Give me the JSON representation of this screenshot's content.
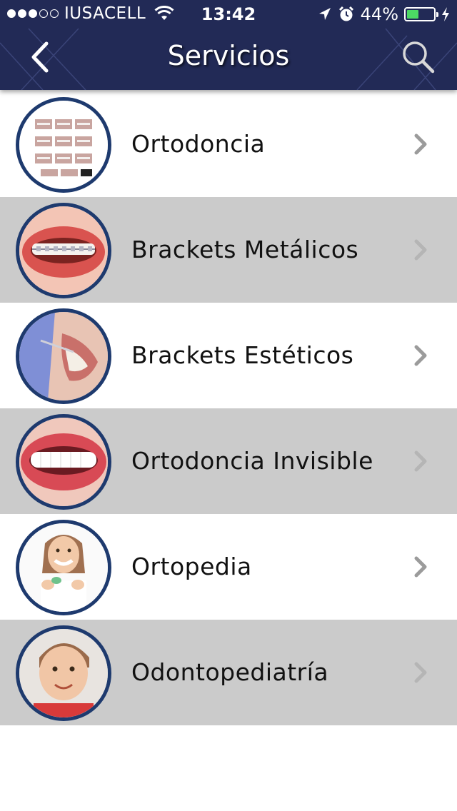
{
  "status_bar": {
    "carrier": "IUSACELL",
    "time": "13:42",
    "battery_percent": "44%",
    "battery_level": 0.44
  },
  "nav": {
    "title": "Servicios",
    "back_icon": "chevron-left-icon",
    "search_icon": "search-icon"
  },
  "colors": {
    "header_bg": "#222a56",
    "row_gray": "#cbcbcb",
    "row_white": "#ffffff",
    "battery_green": "#4cd964",
    "chevron": "#9b9b9b"
  },
  "services": [
    {
      "label": "Ortodoncia",
      "image": "orthodontics-chart-thumbnail"
    },
    {
      "label": "Brackets Metálicos",
      "image": "metal-braces-smile-thumbnail"
    },
    {
      "label": "Brackets Estéticos",
      "image": "aesthetic-braces-thumbnail"
    },
    {
      "label": "Ortodoncia Invisible",
      "image": "invisible-aligner-smile-thumbnail"
    },
    {
      "label": "Ortopedia",
      "image": "girl-holding-retainer-thumbnail"
    },
    {
      "label": "Odontopediatría",
      "image": "smiling-toddler-thumbnail"
    }
  ]
}
